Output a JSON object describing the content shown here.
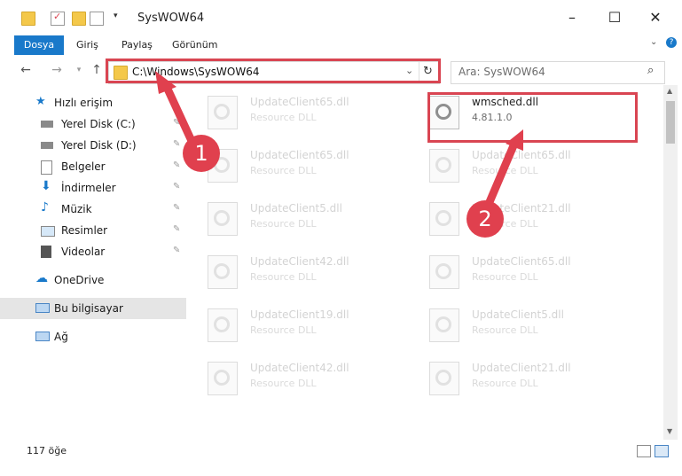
{
  "window": {
    "title": "SysWOW64"
  },
  "ribbon": {
    "tabs": [
      "Dosya",
      "Giriş",
      "Paylaş",
      "Görünüm"
    ]
  },
  "address": {
    "path": "C:\\Windows\\SysWOW64",
    "refresh_icon": "refresh-icon"
  },
  "search": {
    "placeholder": "Ara: SysWOW64"
  },
  "sidebar": {
    "items": [
      {
        "label": "Hızlı erişim",
        "icon": "star-icon"
      },
      {
        "label": "Yerel Disk (C:)",
        "icon": "drive-icon",
        "pinned": true
      },
      {
        "label": "Yerel Disk (D:)",
        "icon": "drive-icon",
        "pinned": true
      },
      {
        "label": "Belgeler",
        "icon": "document-icon",
        "pinned": true
      },
      {
        "label": "İndirmeler",
        "icon": "download-icon",
        "pinned": true
      },
      {
        "label": "Müzik",
        "icon": "music-icon",
        "pinned": true
      },
      {
        "label": "Resimler",
        "icon": "pictures-icon",
        "pinned": true
      },
      {
        "label": "Videolar",
        "icon": "video-icon",
        "pinned": true
      },
      {
        "label": "OneDrive",
        "icon": "cloud-icon"
      },
      {
        "label": "Bu bilgisayar",
        "icon": "computer-icon",
        "selected": true
      },
      {
        "label": "Ağ",
        "icon": "network-icon"
      }
    ]
  },
  "files": {
    "left": [
      {
        "name": "UpdateClient65.dll",
        "type": "Resource DLL"
      },
      {
        "name": "UpdateClient65.dll",
        "type": "Resource DLL"
      },
      {
        "name": "UpdateClient5.dll",
        "type": "Resource DLL"
      },
      {
        "name": "UpdateClient42.dll",
        "type": "Resource DLL"
      },
      {
        "name": "UpdateClient19.dll",
        "type": "Resource DLL"
      },
      {
        "name": "UpdateClient42.dll",
        "type": "Resource DLL"
      }
    ],
    "right": [
      {
        "name": "wmsched.dll",
        "type": "4.81.1.0",
        "highlighted": true
      },
      {
        "name": "UpdateClient65.dll",
        "type": "Resource DLL"
      },
      {
        "name": "UpdateClient21.dll",
        "type": "Resource DLL"
      },
      {
        "name": "UpdateClient65.dll",
        "type": "Resource DLL"
      },
      {
        "name": "UpdateClient5.dll",
        "type": "Resource DLL"
      },
      {
        "name": "UpdateClient21.dll",
        "type": "Resource DLL"
      }
    ]
  },
  "status": {
    "count": "117 öğe"
  },
  "annotations": {
    "step1": "1",
    "step2": "2",
    "highlight_color": "#d94552"
  }
}
